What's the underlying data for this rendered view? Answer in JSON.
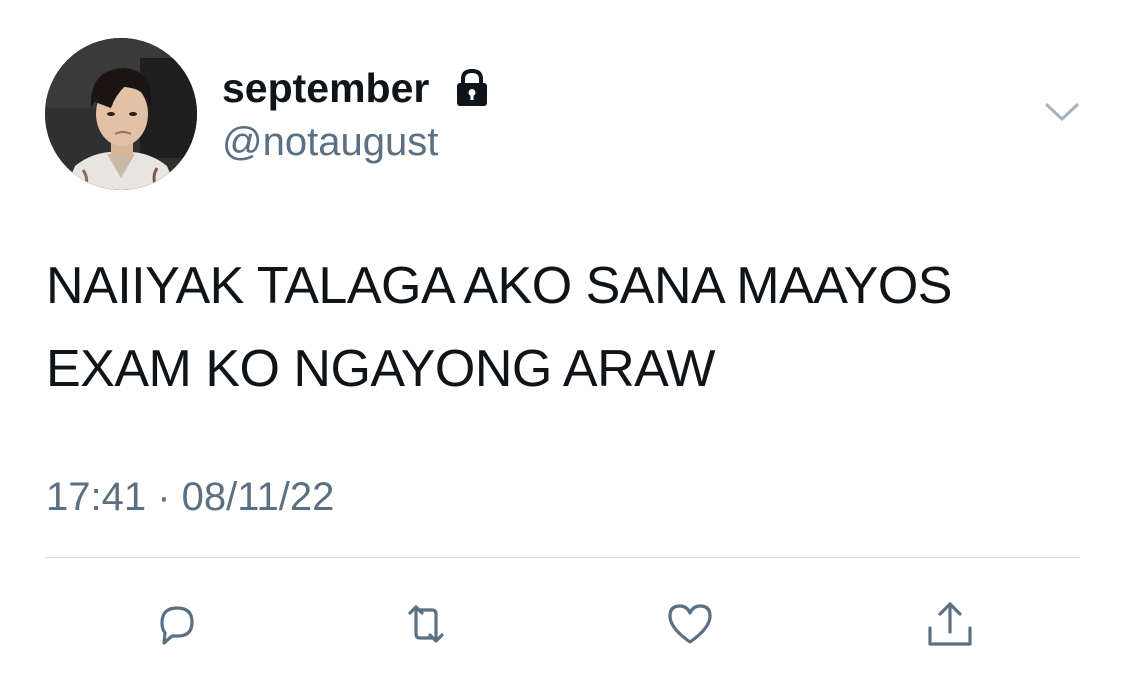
{
  "user": {
    "display_name": "september",
    "handle": "@notaugust",
    "protected": true,
    "avatar_description": "profile photo"
  },
  "tweet": {
    "text": "NAIIYAK TALAGA AKO SANA MAAYOS EXAM KO NGAYONG ARAW",
    "timestamp": "17:41 · 08/11/22"
  },
  "icons": {
    "lock": "lock-icon",
    "menu": "chevron-down-icon",
    "reply": "reply-icon",
    "retweet": "retweet-icon",
    "like": "heart-icon",
    "share": "share-icon"
  },
  "colors": {
    "text": "#0f1419",
    "secondary": "#5b7083",
    "divider": "#d9dee3",
    "icon": "#5b7083"
  }
}
